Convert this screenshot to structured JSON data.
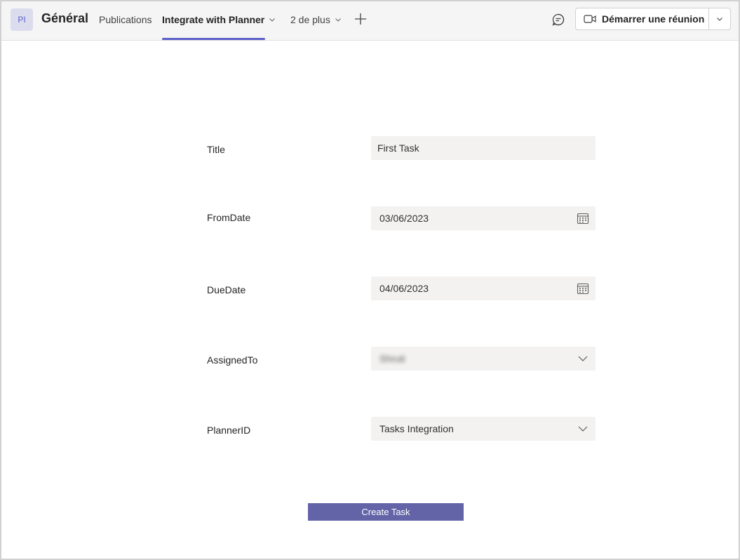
{
  "header": {
    "avatar_initials": "PI",
    "channel_title": "Général",
    "tabs": [
      {
        "label": "Publications"
      },
      {
        "label": "Integrate with Planner"
      },
      {
        "label": "2 de plus"
      }
    ],
    "meet_button_label": "Démarrer une réunion"
  },
  "form": {
    "title_label": "Title",
    "title_value": "First Task",
    "fromdate_label": "FromDate",
    "fromdate_value": "03/06/2023",
    "duedate_label": "DueDate",
    "duedate_value": "04/06/2023",
    "assignedto_label": "AssignedTo",
    "assignedto_value": "Shruti",
    "plannerid_label": "PlannerID",
    "plannerid_value": "Tasks Integration",
    "submit_label": "Create Task"
  },
  "colors": {
    "accent": "#5b5fc7",
    "button": "#6264a7",
    "field_bg": "#f3f2f1",
    "topbar_bg": "#f5f5f5"
  }
}
